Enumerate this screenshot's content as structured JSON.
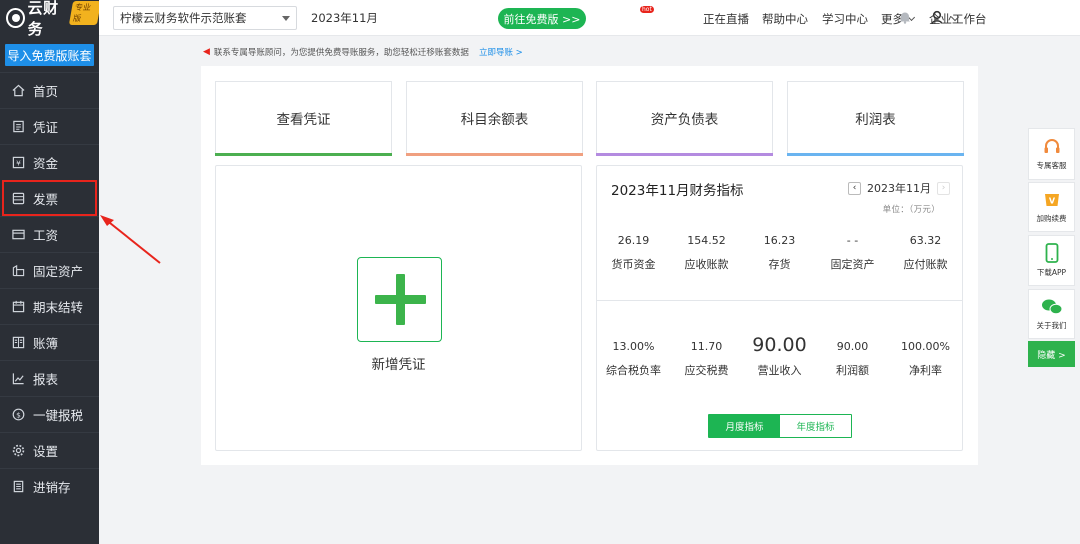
{
  "sidebar": {
    "logo_text": "云财务",
    "logo_badge": "专业版",
    "import_button": "导入免费版账套",
    "items": [
      {
        "label": "首页",
        "icon": "home-icon"
      },
      {
        "label": "凭证",
        "icon": "voucher-icon"
      },
      {
        "label": "资金",
        "icon": "fund-icon"
      },
      {
        "label": "发票",
        "icon": "invoice-icon"
      },
      {
        "label": "工资",
        "icon": "salary-icon"
      },
      {
        "label": "固定资产",
        "icon": "asset-icon"
      },
      {
        "label": "期末结转",
        "icon": "calendar-icon"
      },
      {
        "label": "账簿",
        "icon": "ledger-icon"
      },
      {
        "label": "报表",
        "icon": "chart-icon"
      },
      {
        "label": "一键报税",
        "icon": "tax-icon"
      },
      {
        "label": "设置",
        "icon": "gear-icon"
      },
      {
        "label": "进销存",
        "icon": "inventory-icon"
      }
    ],
    "highlight_color": "#e8241c"
  },
  "topbar": {
    "account": "柠檬云财务软件示范账套",
    "period": "2023年11月",
    "free_button": "前往免费版 >>",
    "live": "正在直播",
    "live_badge": "hot",
    "help": "帮助中心",
    "learn": "学习中心",
    "more": "更多",
    "workbench": "企业工作台"
  },
  "notice": {
    "text": "联系专属导账顾问，为您提供免费导账服务，助您轻松迁移账套数据",
    "link": "立即导账 >"
  },
  "quick_cards": [
    {
      "label": "查看凭证",
      "color": "#4caf50"
    },
    {
      "label": "科目余额表",
      "color": "#f0a080"
    },
    {
      "label": "资产负债表",
      "color": "#b48be0"
    },
    {
      "label": "利润表",
      "color": "#6ab4f0"
    }
  ],
  "new_voucher": {
    "label": "新增凭证"
  },
  "indicators": {
    "title": "2023年11月财务指标",
    "month": "2023年11月",
    "unit": "单位：（万元）",
    "row1": [
      {
        "value": "26.19",
        "label": "货币资金"
      },
      {
        "value": "154.52",
        "label": "应收账款"
      },
      {
        "value": "16.23",
        "label": "存货"
      },
      {
        "value": "- -",
        "label": "固定资产"
      },
      {
        "value": "63.32",
        "label": "应付账款"
      }
    ],
    "row2": [
      {
        "value": "13.00%",
        "label": "综合税负率"
      },
      {
        "value": "11.70",
        "label": "应交税费"
      },
      {
        "value": "90.00",
        "label": "营业收入"
      },
      {
        "value": "90.00",
        "label": "利润额"
      },
      {
        "value": "100.00%",
        "label": "净利率"
      }
    ],
    "tabs": [
      "月度指标",
      "年度指标"
    ]
  },
  "float_panel": [
    {
      "label": "专属客服",
      "icon": "headset-icon"
    },
    {
      "label": "加购续费",
      "icon": "vip-icon"
    },
    {
      "label": "下载APP",
      "icon": "phone-icon"
    },
    {
      "label": "关于我们",
      "icon": "wechat-icon"
    }
  ],
  "hide_button": "隐藏 >",
  "colors": {
    "sidebar_bg": "#2b2f36",
    "accent_green": "#1db553",
    "accent_blue": "#1e8fe8"
  }
}
